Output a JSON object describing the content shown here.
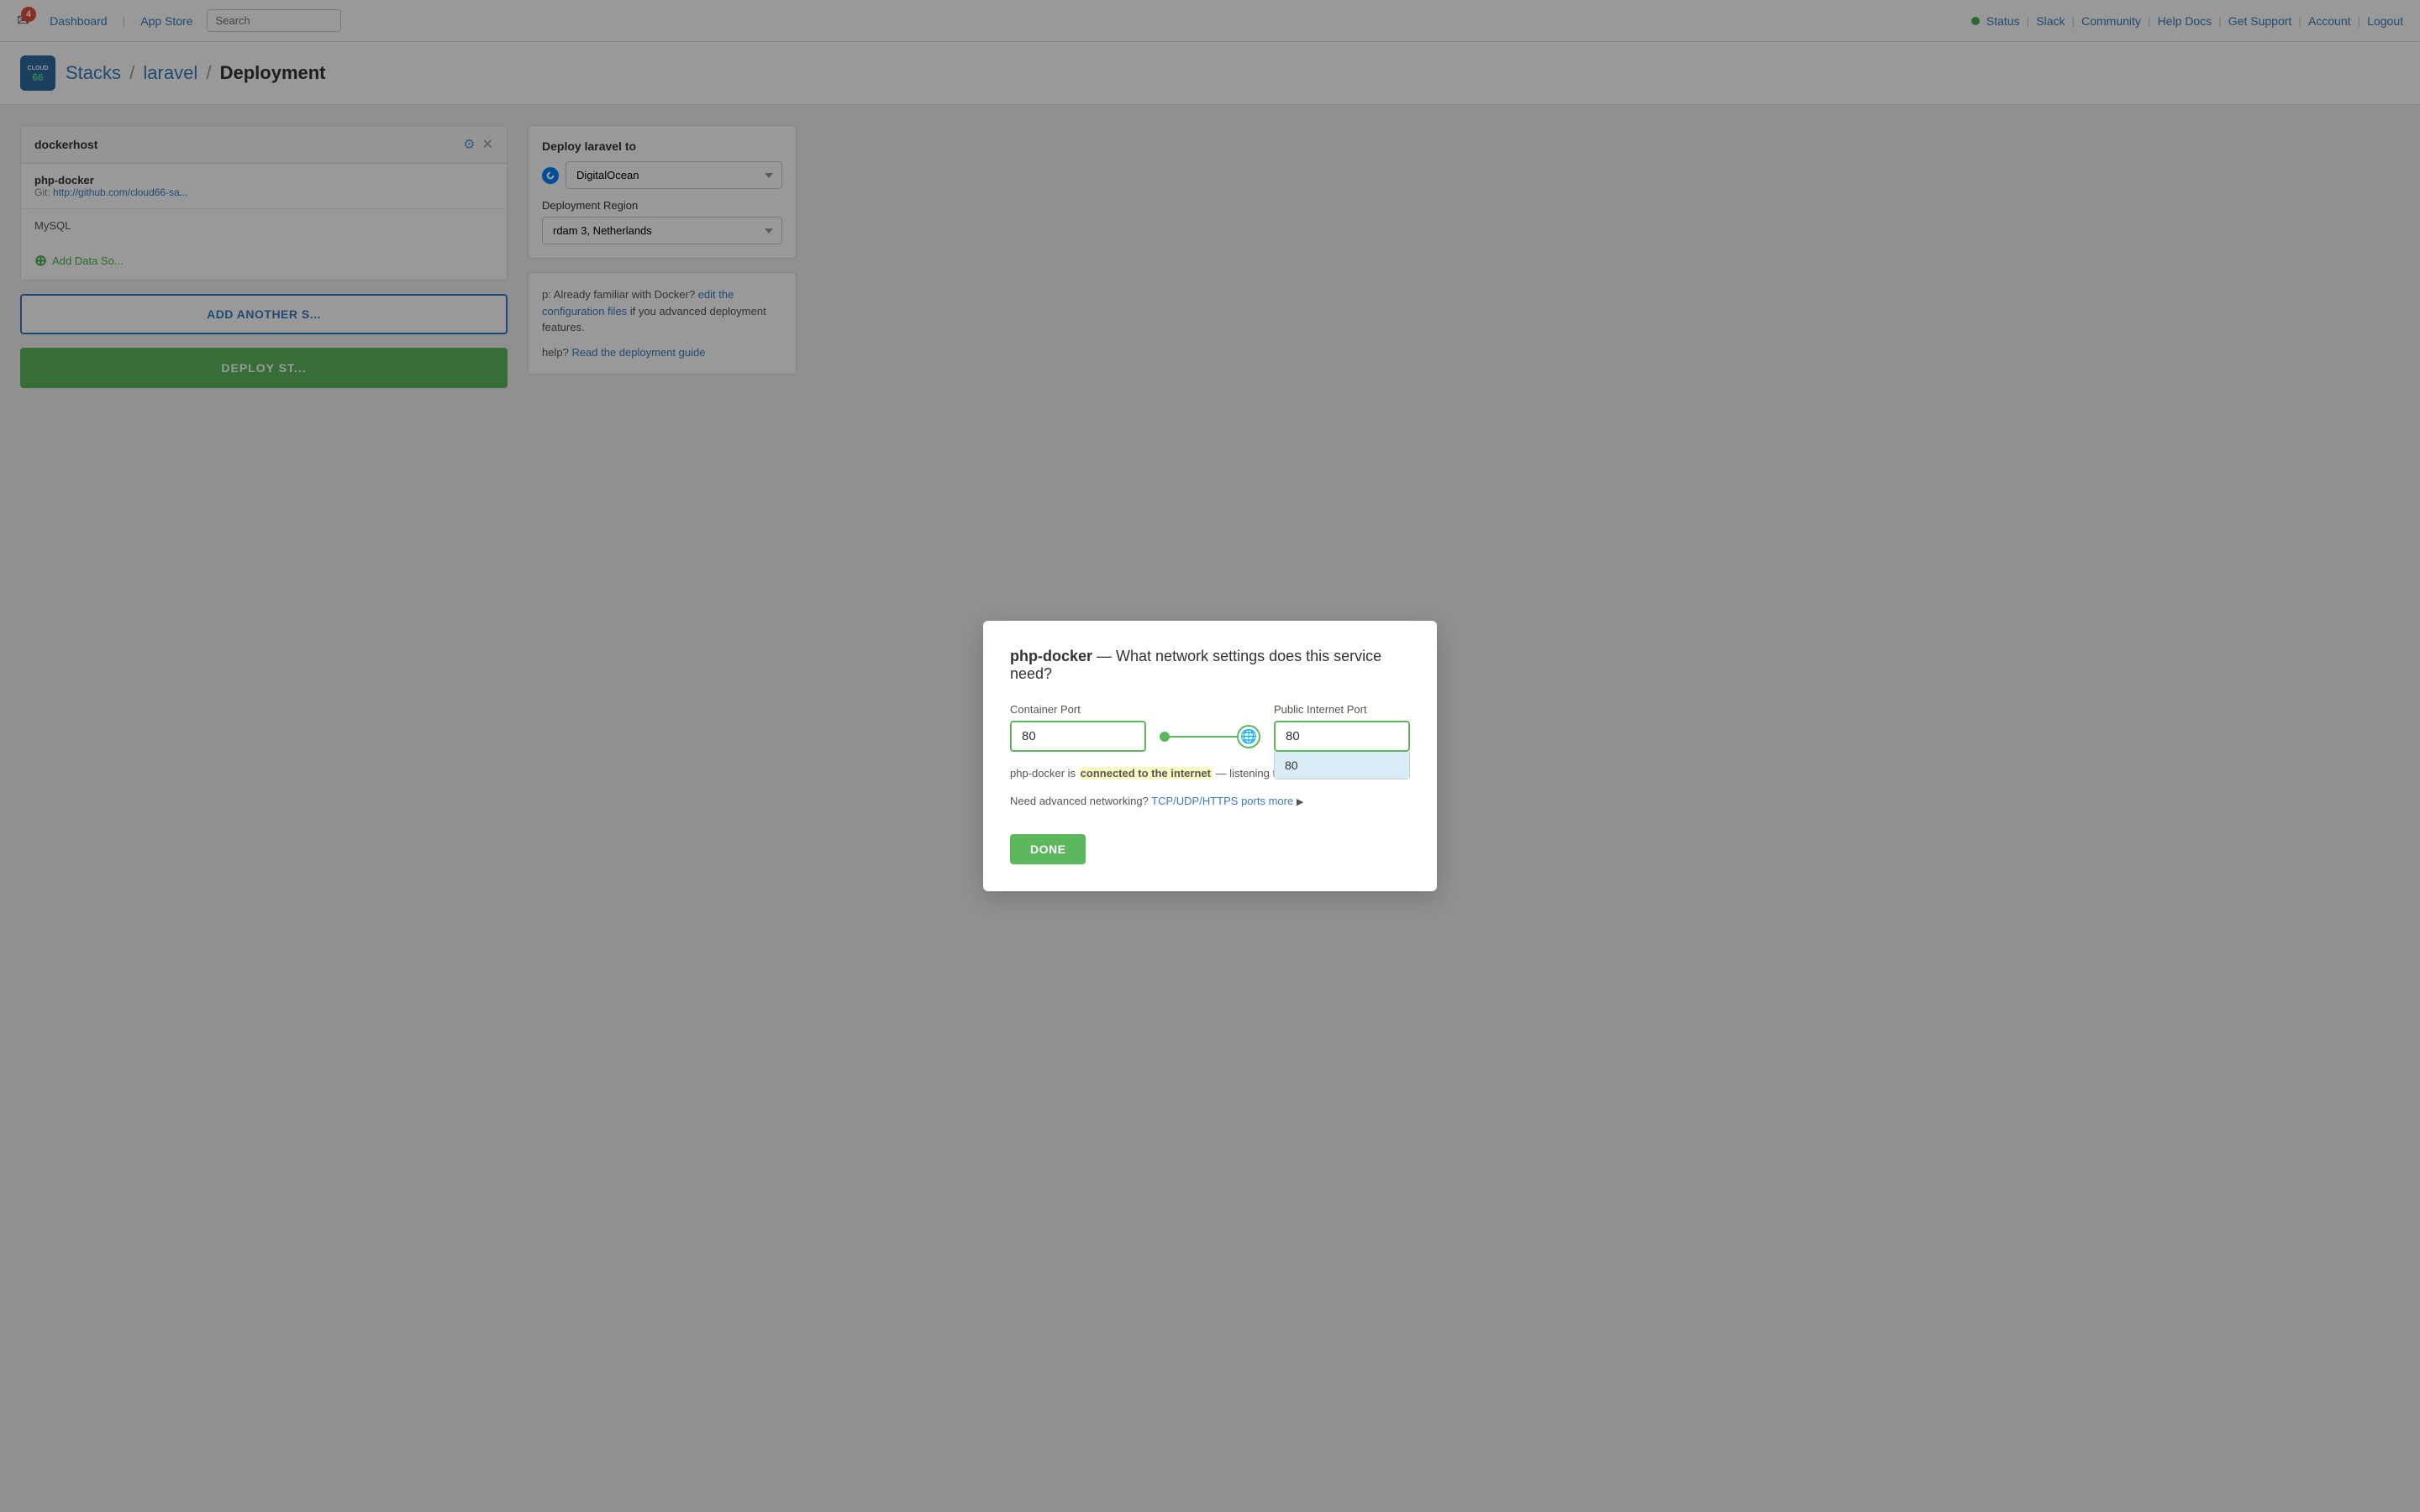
{
  "nav": {
    "dashboard": "Dashboard",
    "appstore": "App Store",
    "search_placeholder": "Search",
    "status": "Status",
    "slack": "Slack",
    "community": "Community",
    "help_docs": "Help Docs",
    "get_support": "Get Support",
    "account": "Account",
    "logout": "Logout",
    "notif_count": "4"
  },
  "breadcrumb": {
    "stacks": "Stacks",
    "sep1": "/",
    "laravel": "laravel",
    "sep2": "/",
    "current": "Deployment"
  },
  "logo": {
    "line1": "CLOUD",
    "line2": "66"
  },
  "service_card": {
    "title": "dockerhost",
    "service_name": "php-docker",
    "service_git_label": "Git:",
    "service_git_url": "http://github.com/cloud66-sa...",
    "mysql_label": "MySQL",
    "add_data_source": "Add Data So..."
  },
  "buttons": {
    "add_another": "ADD ANOTHER S...",
    "deploy": "DEPLOY ST..."
  },
  "right_panel": {
    "deploy_title": "Deploy laravel to",
    "provider": "DigitalOcean",
    "region_label": "Deployment Region",
    "region_value": "rdam 3, Netherlands"
  },
  "info_panel": {
    "docker_text": "p: Already familiar with Docker?",
    "docker_link": "edit the configuration files",
    "docker_after": " if you advanced deployment features.",
    "help_text": "help?",
    "help_link": "Read the deployment guide"
  },
  "modal": {
    "service_name": "php-docker",
    "title_suffix": "— What network settings does this service need?",
    "container_port_label": "Container Port",
    "container_port_value": "80",
    "public_port_label": "Public Internet Port",
    "public_port_value": "80",
    "public_port_dropdown": "80",
    "internet_notice_prefix": "php-docker is ",
    "internet_notice_highlight": "connected to the internet",
    "internet_notice_suffix": " — listening to port 80.",
    "advanced_text": "Need advanced networking?",
    "advanced_link": "TCP/UDP/HTTPS ports more",
    "done_label": "DONE"
  }
}
